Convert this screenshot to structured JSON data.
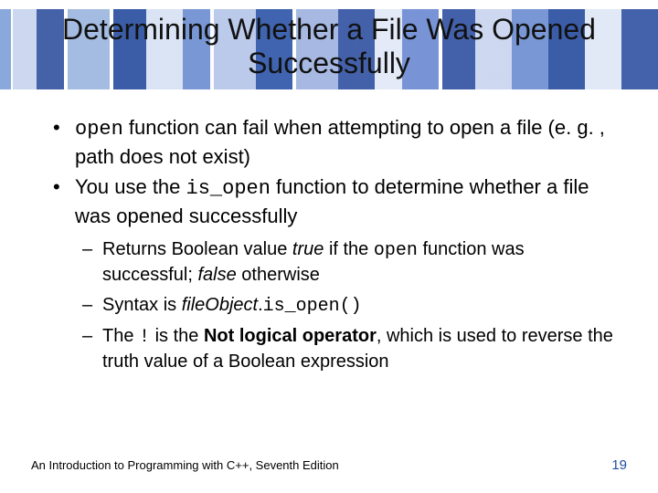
{
  "title": "Determining Whether a File Was Opened Successfully",
  "bullets": {
    "b1": {
      "code1": "open",
      "t1": " function can fail when attempting to open a file (e. g. , path does not exist)"
    },
    "b2": {
      "t1": "You use the ",
      "code1": "is_open",
      "t2": " function to determine whether a file was opened successfully"
    },
    "sub": {
      "s1": {
        "t1": "Returns Boolean value ",
        "em1": "true",
        "t2": " if the ",
        "code1": "open",
        "t3": " function was successful; ",
        "em2": "false",
        "t4": " otherwise"
      },
      "s2": {
        "t1": "Syntax is ",
        "em1": "fileObject",
        "t2": ".",
        "code1": "is_open()"
      },
      "s3": {
        "t1": "The ",
        "code1": "!",
        "t2": " is the ",
        "b1": "Not logical operator",
        "t3": ", which is used to reverse the truth value of a Boolean expression"
      }
    }
  },
  "footer": {
    "book": "An Introduction to Programming with C++, Seventh Edition",
    "page": "19"
  }
}
